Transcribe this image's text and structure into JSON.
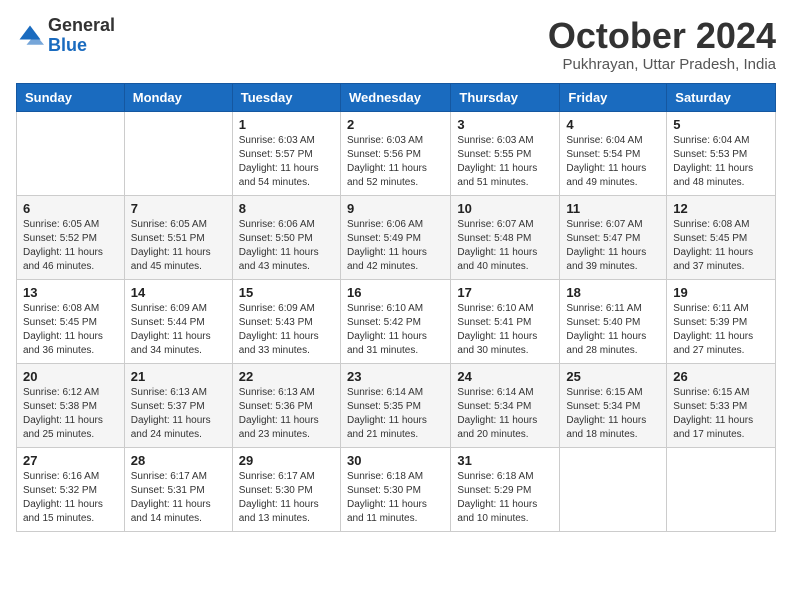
{
  "header": {
    "logo": {
      "general": "General",
      "blue": "Blue"
    },
    "title": "October 2024",
    "location": "Pukhrayan, Uttar Pradesh, India"
  },
  "days_of_week": [
    "Sunday",
    "Monday",
    "Tuesday",
    "Wednesday",
    "Thursday",
    "Friday",
    "Saturday"
  ],
  "weeks": [
    [
      {
        "day": "",
        "info": ""
      },
      {
        "day": "",
        "info": ""
      },
      {
        "day": "1",
        "info": "Sunrise: 6:03 AM\nSunset: 5:57 PM\nDaylight: 11 hours and 54 minutes."
      },
      {
        "day": "2",
        "info": "Sunrise: 6:03 AM\nSunset: 5:56 PM\nDaylight: 11 hours and 52 minutes."
      },
      {
        "day": "3",
        "info": "Sunrise: 6:03 AM\nSunset: 5:55 PM\nDaylight: 11 hours and 51 minutes."
      },
      {
        "day": "4",
        "info": "Sunrise: 6:04 AM\nSunset: 5:54 PM\nDaylight: 11 hours and 49 minutes."
      },
      {
        "day": "5",
        "info": "Sunrise: 6:04 AM\nSunset: 5:53 PM\nDaylight: 11 hours and 48 minutes."
      }
    ],
    [
      {
        "day": "6",
        "info": "Sunrise: 6:05 AM\nSunset: 5:52 PM\nDaylight: 11 hours and 46 minutes."
      },
      {
        "day": "7",
        "info": "Sunrise: 6:05 AM\nSunset: 5:51 PM\nDaylight: 11 hours and 45 minutes."
      },
      {
        "day": "8",
        "info": "Sunrise: 6:06 AM\nSunset: 5:50 PM\nDaylight: 11 hours and 43 minutes."
      },
      {
        "day": "9",
        "info": "Sunrise: 6:06 AM\nSunset: 5:49 PM\nDaylight: 11 hours and 42 minutes."
      },
      {
        "day": "10",
        "info": "Sunrise: 6:07 AM\nSunset: 5:48 PM\nDaylight: 11 hours and 40 minutes."
      },
      {
        "day": "11",
        "info": "Sunrise: 6:07 AM\nSunset: 5:47 PM\nDaylight: 11 hours and 39 minutes."
      },
      {
        "day": "12",
        "info": "Sunrise: 6:08 AM\nSunset: 5:45 PM\nDaylight: 11 hours and 37 minutes."
      }
    ],
    [
      {
        "day": "13",
        "info": "Sunrise: 6:08 AM\nSunset: 5:45 PM\nDaylight: 11 hours and 36 minutes."
      },
      {
        "day": "14",
        "info": "Sunrise: 6:09 AM\nSunset: 5:44 PM\nDaylight: 11 hours and 34 minutes."
      },
      {
        "day": "15",
        "info": "Sunrise: 6:09 AM\nSunset: 5:43 PM\nDaylight: 11 hours and 33 minutes."
      },
      {
        "day": "16",
        "info": "Sunrise: 6:10 AM\nSunset: 5:42 PM\nDaylight: 11 hours and 31 minutes."
      },
      {
        "day": "17",
        "info": "Sunrise: 6:10 AM\nSunset: 5:41 PM\nDaylight: 11 hours and 30 minutes."
      },
      {
        "day": "18",
        "info": "Sunrise: 6:11 AM\nSunset: 5:40 PM\nDaylight: 11 hours and 28 minutes."
      },
      {
        "day": "19",
        "info": "Sunrise: 6:11 AM\nSunset: 5:39 PM\nDaylight: 11 hours and 27 minutes."
      }
    ],
    [
      {
        "day": "20",
        "info": "Sunrise: 6:12 AM\nSunset: 5:38 PM\nDaylight: 11 hours and 25 minutes."
      },
      {
        "day": "21",
        "info": "Sunrise: 6:13 AM\nSunset: 5:37 PM\nDaylight: 11 hours and 24 minutes."
      },
      {
        "day": "22",
        "info": "Sunrise: 6:13 AM\nSunset: 5:36 PM\nDaylight: 11 hours and 23 minutes."
      },
      {
        "day": "23",
        "info": "Sunrise: 6:14 AM\nSunset: 5:35 PM\nDaylight: 11 hours and 21 minutes."
      },
      {
        "day": "24",
        "info": "Sunrise: 6:14 AM\nSunset: 5:34 PM\nDaylight: 11 hours and 20 minutes."
      },
      {
        "day": "25",
        "info": "Sunrise: 6:15 AM\nSunset: 5:34 PM\nDaylight: 11 hours and 18 minutes."
      },
      {
        "day": "26",
        "info": "Sunrise: 6:15 AM\nSunset: 5:33 PM\nDaylight: 11 hours and 17 minutes."
      }
    ],
    [
      {
        "day": "27",
        "info": "Sunrise: 6:16 AM\nSunset: 5:32 PM\nDaylight: 11 hours and 15 minutes."
      },
      {
        "day": "28",
        "info": "Sunrise: 6:17 AM\nSunset: 5:31 PM\nDaylight: 11 hours and 14 minutes."
      },
      {
        "day": "29",
        "info": "Sunrise: 6:17 AM\nSunset: 5:30 PM\nDaylight: 11 hours and 13 minutes."
      },
      {
        "day": "30",
        "info": "Sunrise: 6:18 AM\nSunset: 5:30 PM\nDaylight: 11 hours and 11 minutes."
      },
      {
        "day": "31",
        "info": "Sunrise: 6:18 AM\nSunset: 5:29 PM\nDaylight: 11 hours and 10 minutes."
      },
      {
        "day": "",
        "info": ""
      },
      {
        "day": "",
        "info": ""
      }
    ]
  ]
}
